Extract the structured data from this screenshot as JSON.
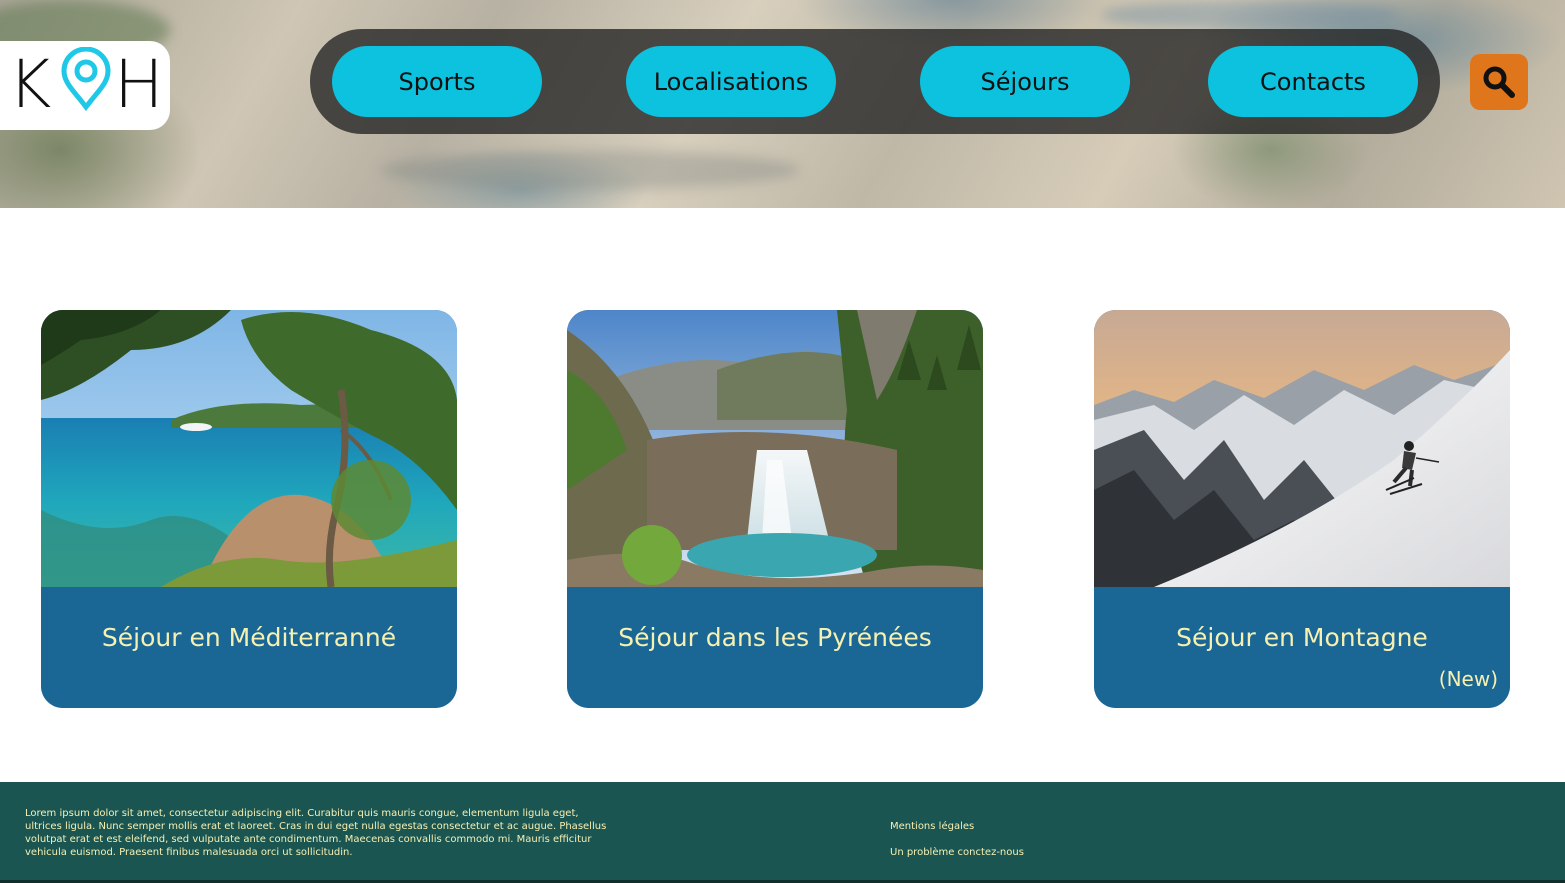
{
  "header": {
    "logo": {
      "left_letter": "K",
      "right_letter": "H",
      "pin_color": "#1ec8e6"
    },
    "nav": {
      "items": [
        {
          "label": "Sports"
        },
        {
          "label": "Localisations"
        },
        {
          "label": "Séjours"
        },
        {
          "label": "Contacts"
        }
      ],
      "button_color": "#0cc2de"
    },
    "search": {
      "icon": "search-icon",
      "color": "#e0761c"
    }
  },
  "cards": [
    {
      "title": "Séjour en Méditerranné",
      "badge": "",
      "image": "mediterranean-coast-photo"
    },
    {
      "title": "Séjour dans les Pyrénées",
      "badge": "",
      "image": "pyrenees-waterfall-photo"
    },
    {
      "title": "Séjour en Montagne",
      "badge": "(New)",
      "image": "mountain-skier-photo"
    }
  ],
  "footer": {
    "lorem": "Lorem ipsum dolor sit amet, consectetur adipiscing elit. Curabitur quis mauris congue, elementum ligula eget, ultrices ligula. Nunc semper mollis erat et laoreet. Cras in dui eget nulla egestas consectetur et ac augue. Phasellus volutpat erat et est eleifend, sed vulputate ante condimentum. Maecenas convallis commodo mi. Mauris efficitur vehicula euismod. Praesent finibus malesuada orci ut sollicitudin.",
    "legal_link": "Mentions légales",
    "contact_link": "Un problème conctez-nous"
  },
  "colors": {
    "card_caption": "#1a6795",
    "caption_text": "#f6f0b2",
    "footer_bg": "#1b5552"
  }
}
